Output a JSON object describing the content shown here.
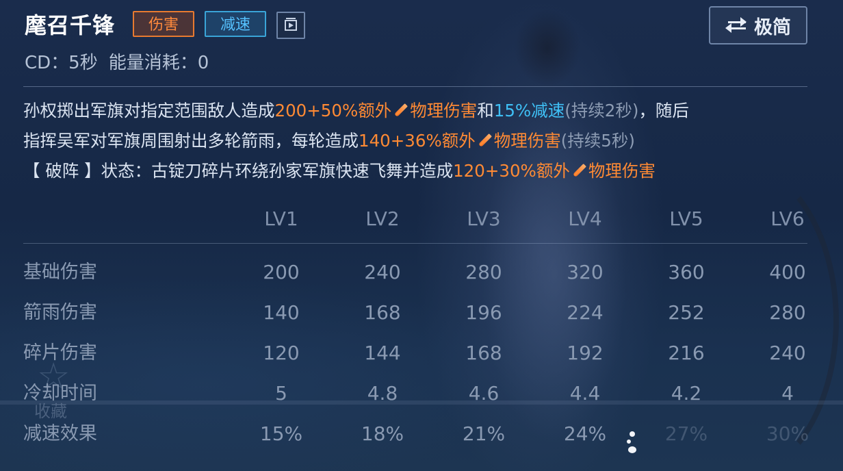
{
  "skill": {
    "name": "麾召千锋",
    "tags": {
      "damage": "伤害",
      "slow": "减速"
    },
    "cd_line": {
      "cd": "CD：5秒",
      "energy": "能量消耗：0"
    }
  },
  "toggle_button": {
    "label": "极简"
  },
  "description": {
    "line1": {
      "a": "孙权掷出军旗对指定范围敌人造成",
      "b": "200+50%额外",
      "c": "物理伤害",
      "d": "和",
      "e": "15%减速",
      "f": "(持续2秒)",
      "g": "，随后"
    },
    "line2": {
      "a": "指挥吴军对军旗周围射出多轮箭雨，每轮造成",
      "b": "140+36%额外",
      "c": "物理伤害",
      "d": "(持续5秒)"
    },
    "line3": {
      "a": "【 破阵 】状态：古锭刀碎片环绕孙家军旗快速飞舞并造成",
      "b": "120+30%额外",
      "c": "物理伤害"
    }
  },
  "table": {
    "levels": [
      "LV1",
      "LV2",
      "LV3",
      "LV4",
      "LV5",
      "LV6"
    ],
    "rows": [
      {
        "label": "基础伤害",
        "values": [
          "200",
          "240",
          "280",
          "320",
          "360",
          "400"
        ]
      },
      {
        "label": "箭雨伤害",
        "values": [
          "140",
          "168",
          "196",
          "224",
          "252",
          "280"
        ]
      },
      {
        "label": "碎片伤害",
        "values": [
          "120",
          "144",
          "168",
          "192",
          "216",
          "240"
        ]
      },
      {
        "label": "冷却时间",
        "values": [
          "5",
          "4.8",
          "4.6",
          "4.4",
          "4.2",
          "4"
        ]
      },
      {
        "label": "减速效果",
        "values": [
          "15%",
          "18%",
          "21%",
          "24%",
          "27%",
          "30%"
        ]
      }
    ]
  },
  "favorite": {
    "label": "收藏"
  },
  "colors": {
    "damage_orange": "#ff8a34",
    "slow_blue": "#3fc0f6",
    "muted_text": "#8a9ab2"
  },
  "icons": {
    "video": "video-icon",
    "swap": "swap-arrows-icon",
    "physical_damage": "sword-icon",
    "favorite": "star-icon"
  }
}
